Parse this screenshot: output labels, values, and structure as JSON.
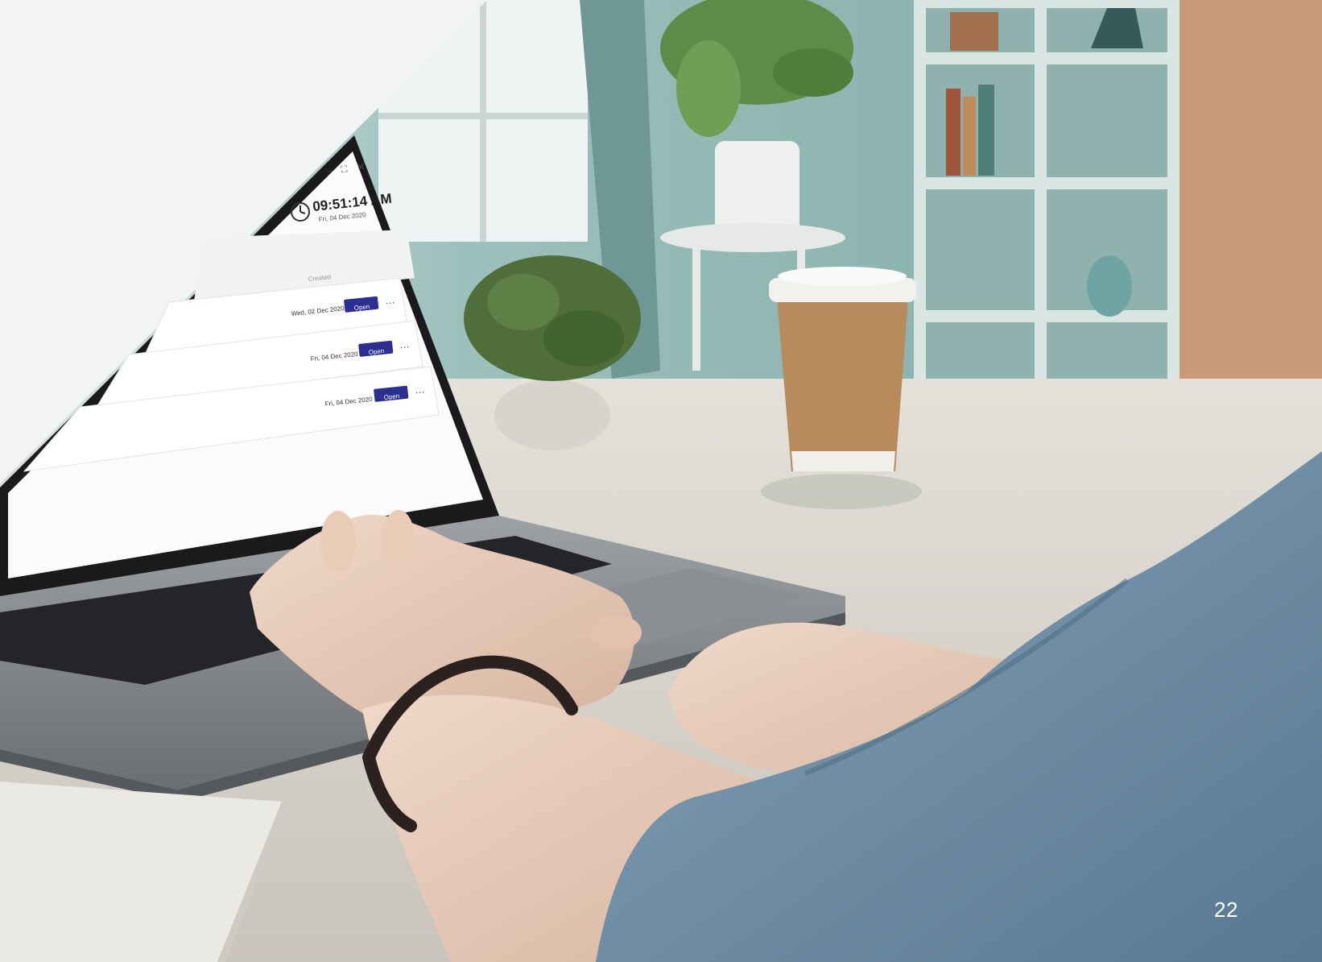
{
  "clock": {
    "time": "09:51:14 AM",
    "date": "Fri, 04 Dec 2020"
  },
  "table": {
    "created_header": "Created",
    "rows": [
      {
        "date": "Wed, 02 Dec 2020",
        "action": "Open"
      },
      {
        "date": "Fri, 04 Dec 2020",
        "action": "Open"
      },
      {
        "date": "Fri, 04 Dec 2020",
        "action": "Open"
      }
    ]
  },
  "page_number": "22",
  "colors": {
    "button": "#2b2f8f",
    "panel": "#f2f3f4",
    "wall": "#8fbab6",
    "desk": "#dcd8d0",
    "sleeve": "#6f8fa8",
    "cup": "#b88a5c"
  }
}
